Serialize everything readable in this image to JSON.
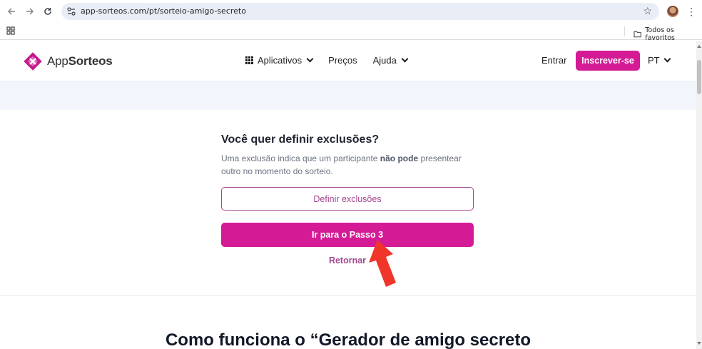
{
  "browser": {
    "url": "app-sorteos.com/pt/sorteio-amigo-secreto",
    "bookmarks_all_label": "Todos os favoritos"
  },
  "header": {
    "logo_light": "App",
    "logo_bold": "Sorteos",
    "nav": {
      "apps_label": "Aplicativos",
      "prices_label": "Preços",
      "help_label": "Ajuda"
    },
    "login_label": "Entrar",
    "signup_label": "Inscrever-se",
    "language_label": "PT"
  },
  "step": {
    "title": "Você quer definir exclusões?",
    "desc_part1": "Uma exclusão indica que um participante ",
    "desc_bold": "não pode",
    "desc_part2": " presentear outro no momento do sorteio.",
    "define_button": "Definir exclusões",
    "next_button": "Ir para o Passo 3",
    "back_link": "Retornar"
  },
  "section": {
    "title": "Como funciona o “Gerador de amigo secreto"
  },
  "colors": {
    "brand": "#d41b95",
    "brand_dark": "#a3478e",
    "band": "#f2f5fb",
    "annotation_arrow": "#f0352a"
  }
}
